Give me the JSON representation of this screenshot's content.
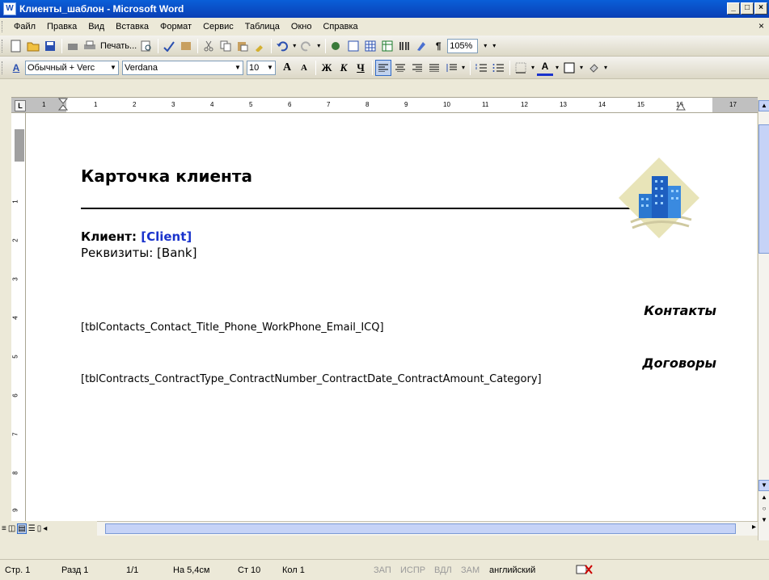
{
  "window": {
    "title": "Клиенты_шаблон - Microsoft Word",
    "app_icon": "W"
  },
  "menu": [
    "Файл",
    "Правка",
    "Вид",
    "Вставка",
    "Формат",
    "Сервис",
    "Таблица",
    "Окно",
    "Справка"
  ],
  "toolbar1": {
    "print_label": "Печать...",
    "zoom": "105%"
  },
  "toolbar2": {
    "style": "Обычный + Verc",
    "font": "Verdana",
    "size": "10",
    "bold_glyph": "Ж",
    "italic_glyph": "К",
    "underline_glyph": "Ч"
  },
  "ruler": {
    "corner": "L",
    "numbers": [
      "1",
      "1",
      "2",
      "3",
      "4",
      "5",
      "6",
      "7",
      "8",
      "9",
      "10",
      "11",
      "12",
      "13",
      "14",
      "15",
      "16",
      "17"
    ]
  },
  "vruler": {
    "numbers": [
      "1",
      "2",
      "3",
      "4",
      "5",
      "6",
      "7",
      "8",
      "9"
    ]
  },
  "document": {
    "title": "Карточка клиента",
    "client_label": "Клиент:",
    "client_field": "[Client]",
    "bank_line": "Реквизиты: [Bank]",
    "contacts_heading": "Контакты",
    "contacts_field": "[tblContacts_Contact_Title_Phone_WorkPhone_Email_ICQ]",
    "contracts_heading": "Договоры",
    "contracts_field": "[tblContracts_ContractType_ContractNumber_ContractDate_ContractAmount_Category]"
  },
  "status": {
    "page": "Стр. 1",
    "section": "Разд 1",
    "pages": "1/1",
    "at": "На 5,4см",
    "line": "Ст 10",
    "col": "Кол 1",
    "rec": "ЗАП",
    "trk": "ИСПР",
    "ext": "ВДЛ",
    "ovr": "ЗАМ",
    "lang": "английский"
  }
}
